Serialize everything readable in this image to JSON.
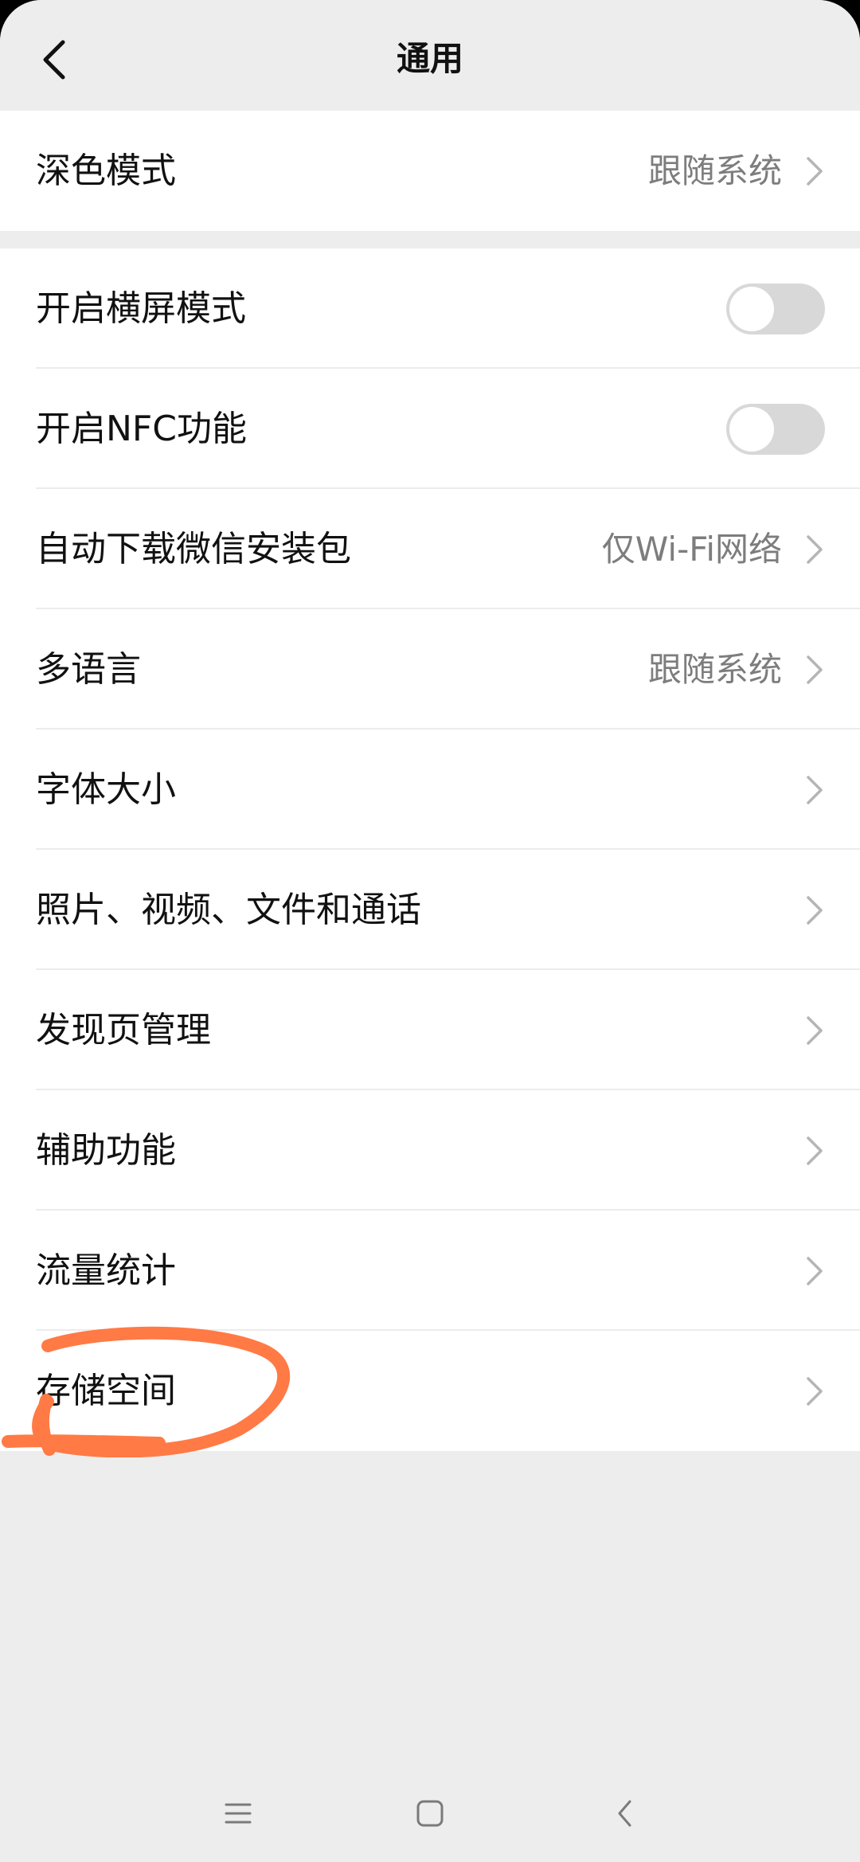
{
  "header": {
    "title": "通用",
    "back_icon": "chevron-left-icon"
  },
  "group1": [
    {
      "label": "深色模式",
      "value": "跟随系统",
      "type": "link"
    }
  ],
  "group2": [
    {
      "label": "开启横屏模式",
      "type": "toggle",
      "on": false
    },
    {
      "label": "开启NFC功能",
      "type": "toggle",
      "on": false
    },
    {
      "label": "自动下载微信安装包",
      "value": "仅Wi-Fi网络",
      "type": "link"
    },
    {
      "label": "多语言",
      "value": "跟随系统",
      "type": "link"
    },
    {
      "label": "字体大小",
      "type": "link"
    },
    {
      "label": "照片、视频、文件和通话",
      "type": "link"
    },
    {
      "label": "发现页管理",
      "type": "link"
    },
    {
      "label": "辅助功能",
      "type": "link"
    },
    {
      "label": "流量统计",
      "type": "link"
    },
    {
      "label": "存储空间",
      "type": "link",
      "highlighted": true
    }
  ],
  "navbar": {
    "icons": [
      "menu-icon",
      "home-icon",
      "back-icon"
    ]
  },
  "colors": {
    "background": "#ededed",
    "annotation": "#ff7a45",
    "secondary_text": "#7d7d7d"
  }
}
